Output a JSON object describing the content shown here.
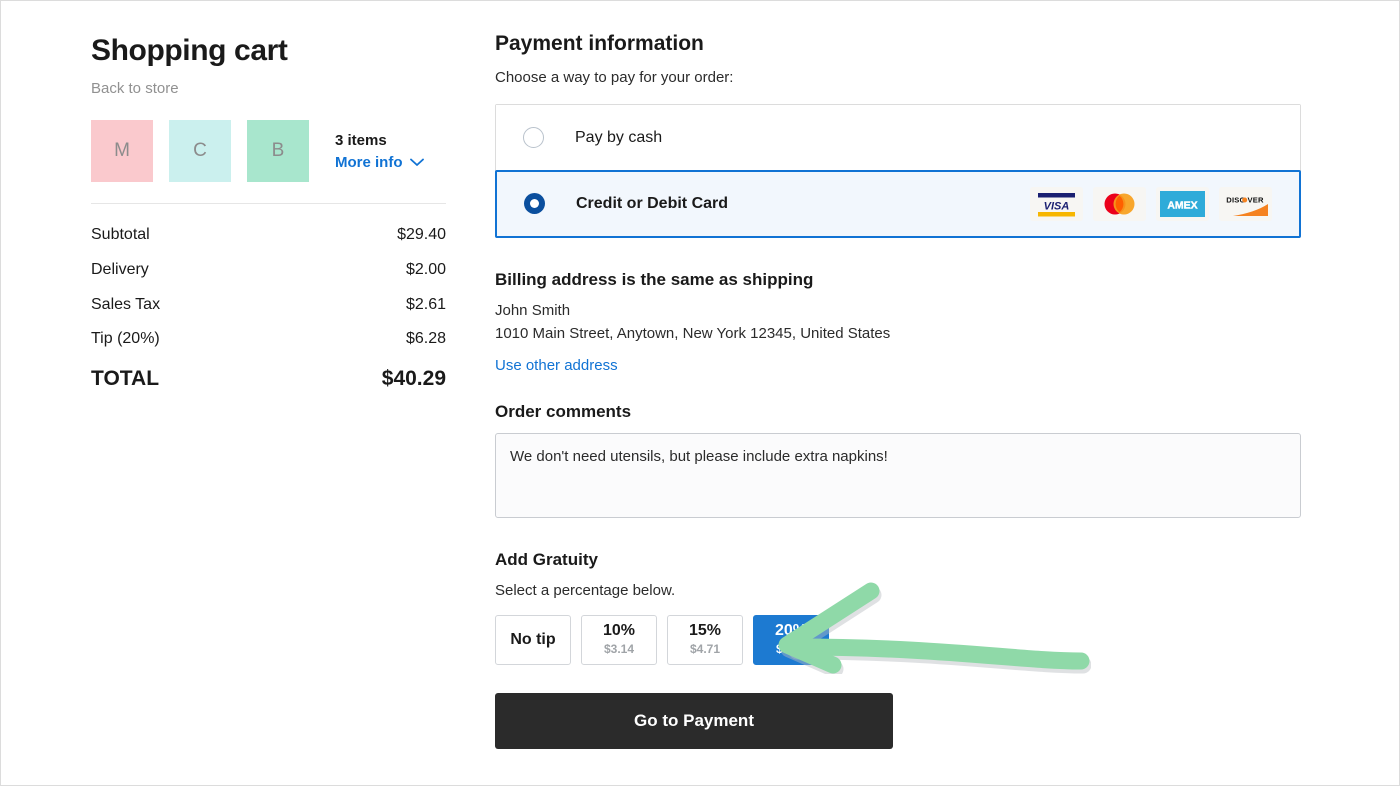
{
  "cart": {
    "title": "Shopping cart",
    "back_link": "Back to store",
    "items": [
      {
        "initial": "M",
        "color": "#fac9cd"
      },
      {
        "initial": "C",
        "color": "#cbf0ee"
      },
      {
        "initial": "B",
        "color": "#a8e6cd"
      }
    ],
    "items_count": "3 items",
    "more_info": "More info",
    "lines": [
      {
        "label": "Subtotal",
        "value": "$29.40"
      },
      {
        "label": "Delivery",
        "value": "$2.00"
      },
      {
        "label": "Sales Tax",
        "value": "$2.61"
      },
      {
        "label": "Tip (20%)",
        "value": "$6.28"
      }
    ],
    "total_label": "TOTAL",
    "total_value": "$40.29"
  },
  "payment": {
    "title": "Payment information",
    "subtitle": "Choose a way to pay for your order:",
    "options": [
      {
        "label": "Pay by cash",
        "selected": false
      },
      {
        "label": "Credit or Debit Card",
        "selected": true
      }
    ],
    "accepted_cards": [
      "visa",
      "mastercard",
      "amex",
      "discover"
    ]
  },
  "billing": {
    "title": "Billing address is the same as shipping",
    "name": "John Smith",
    "address": "1010 Main Street, Anytown, New York 12345, United States",
    "other_address_link": "Use other address"
  },
  "comments": {
    "title": "Order comments",
    "value": "We don't need utensils, but please include extra napkins!",
    "placeholder": ""
  },
  "gratuity": {
    "title": "Add Gratuity",
    "subtitle": "Select a percentage below.",
    "options": [
      {
        "percent": "No tip",
        "amount": "",
        "selected": false
      },
      {
        "percent": "10%",
        "amount": "$3.14",
        "selected": false
      },
      {
        "percent": "15%",
        "amount": "$4.71",
        "selected": false
      },
      {
        "percent": "20%",
        "amount": "$6.28",
        "selected": true
      }
    ]
  },
  "submit": {
    "label": "Go to Payment"
  },
  "colors": {
    "accent_blue": "#1173d4",
    "selected_tip_blue": "#1d7ad1",
    "radio_selected": "#0b4f9e",
    "submit_dark": "#2b2b2b",
    "annotation_green": "#8fd9a8"
  }
}
